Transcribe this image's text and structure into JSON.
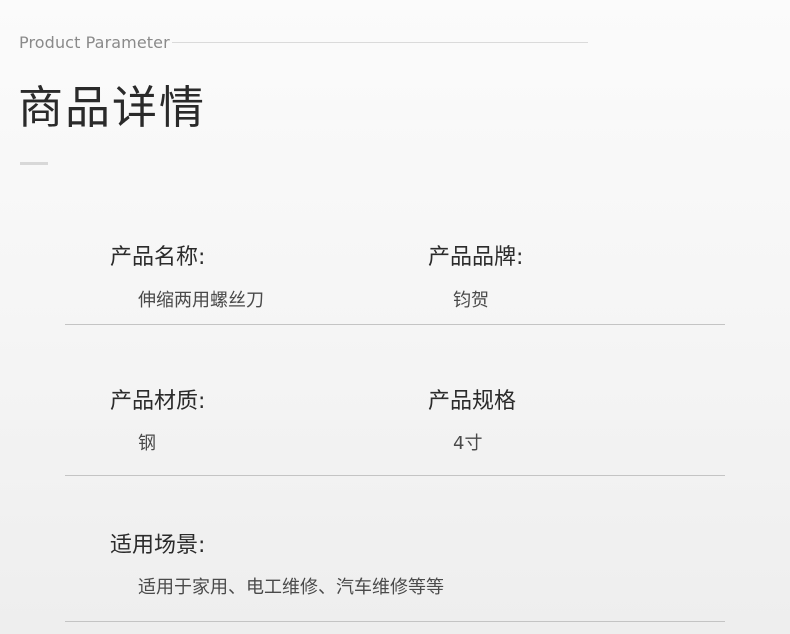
{
  "header": {
    "subtitle_en": "Product Parameter",
    "title_cn": "商品详情"
  },
  "params": {
    "name": {
      "label": "产品名称:",
      "value": "伸缩两用螺丝刀"
    },
    "brand": {
      "label": "产品品牌:",
      "value": "钧贺"
    },
    "material": {
      "label": "产品材质:",
      "value": "钢"
    },
    "spec": {
      "label": "产品规格",
      "value": "4寸"
    },
    "usage": {
      "label": "适用场景:",
      "value": "适用于家用、电工维修、汽车维修等等"
    }
  }
}
